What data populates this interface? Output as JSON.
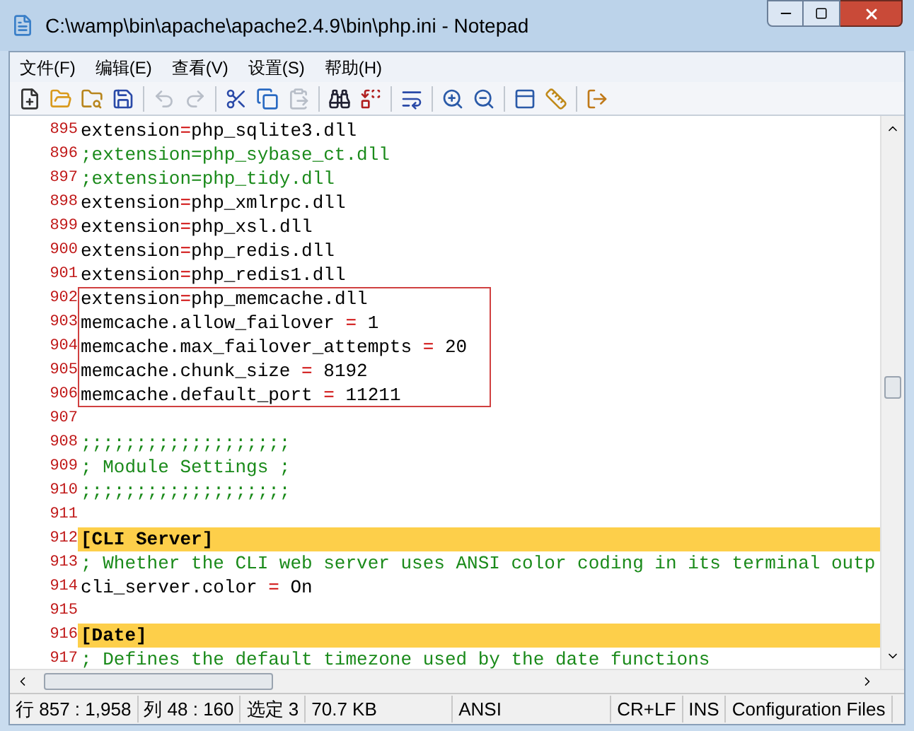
{
  "window": {
    "title": "C:\\wamp\\bin\\apache\\apache2.4.9\\bin\\php.ini - Notepad"
  },
  "menu": [
    "文件(F)",
    "编辑(E)",
    "查看(V)",
    "设置(S)",
    "帮助(H)"
  ],
  "toolbar": [
    {
      "kind": "new",
      "disabled": false
    },
    {
      "kind": "open",
      "disabled": false
    },
    {
      "kind": "browse",
      "disabled": false
    },
    {
      "kind": "save",
      "disabled": false
    },
    {
      "kind": "sep"
    },
    {
      "kind": "undo",
      "disabled": true
    },
    {
      "kind": "redo",
      "disabled": true
    },
    {
      "kind": "sep"
    },
    {
      "kind": "cut",
      "disabled": false
    },
    {
      "kind": "copy",
      "disabled": false
    },
    {
      "kind": "paste",
      "disabled": true
    },
    {
      "kind": "sep"
    },
    {
      "kind": "find",
      "disabled": false
    },
    {
      "kind": "replace",
      "disabled": false
    },
    {
      "kind": "sep"
    },
    {
      "kind": "wrap",
      "disabled": false
    },
    {
      "kind": "sep"
    },
    {
      "kind": "zoomin",
      "disabled": false
    },
    {
      "kind": "zoomout",
      "disabled": false
    },
    {
      "kind": "sep"
    },
    {
      "kind": "view",
      "disabled": false
    },
    {
      "kind": "scheme",
      "disabled": false
    },
    {
      "kind": "sep"
    },
    {
      "kind": "exit",
      "disabled": false
    }
  ],
  "lines": [
    {
      "number": "895",
      "kind": "code",
      "text": "extension=php_sqlite3.dll",
      "boxed": false
    },
    {
      "number": "896",
      "kind": "comment",
      "text": ";extension=php_sybase_ct.dll",
      "boxed": false
    },
    {
      "number": "897",
      "kind": "comment",
      "text": ";extension=php_tidy.dll",
      "boxed": false
    },
    {
      "number": "898",
      "kind": "code",
      "text": "extension=php_xmlrpc.dll",
      "boxed": false
    },
    {
      "number": "899",
      "kind": "code",
      "text": "extension=php_xsl.dll",
      "boxed": false
    },
    {
      "number": "900",
      "kind": "code",
      "text": "extension=php_redis.dll",
      "boxed": false
    },
    {
      "number": "901",
      "kind": "code",
      "text": "extension=php_redis1.dll",
      "boxed": false
    },
    {
      "number": "902",
      "kind": "code",
      "text": "extension=php_memcache.dll",
      "boxed": true
    },
    {
      "number": "903",
      "kind": "code",
      "text": "memcache.allow_failover = 1",
      "boxed": true
    },
    {
      "number": "904",
      "kind": "code",
      "text": "memcache.max_failover_attempts = 20",
      "boxed": true
    },
    {
      "number": "905",
      "kind": "code",
      "text": "memcache.chunk_size = 8192",
      "boxed": true
    },
    {
      "number": "906",
      "kind": "code",
      "text": "memcache.default_port = 11211",
      "boxed": true
    },
    {
      "number": "907",
      "kind": "blank",
      "boxed": false
    },
    {
      "number": "908",
      "kind": "comment",
      "text": ";;;;;;;;;;;;;;;;;;;",
      "boxed": false
    },
    {
      "number": "909",
      "kind": "comment",
      "text": "; Module Settings ;",
      "boxed": false
    },
    {
      "number": "910",
      "kind": "comment",
      "text": ";;;;;;;;;;;;;;;;;;;",
      "boxed": false
    },
    {
      "number": "911",
      "kind": "blank",
      "boxed": false
    },
    {
      "number": "912",
      "kind": "section",
      "text": "[CLI Server]",
      "boxed": false
    },
    {
      "number": "913",
      "kind": "comment",
      "text": "; Whether the CLI web server uses ANSI color coding in its terminal outp",
      "boxed": false
    },
    {
      "number": "914",
      "kind": "code",
      "text": "cli_server.color = On",
      "boxed": false
    },
    {
      "number": "915",
      "kind": "blank",
      "boxed": false
    },
    {
      "number": "916",
      "kind": "section",
      "text": "[Date]",
      "boxed": false
    },
    {
      "number": "917",
      "kind": "comment",
      "text": "; Defines the default timezone used by the date functions",
      "boxed": false
    }
  ],
  "status_bar": [
    "行 857 : 1,958",
    "列 48 : 160",
    "选定 3",
    "70.7 KB",
    "ANSI",
    "CR+LF",
    "INS",
    "Configuration Files"
  ]
}
